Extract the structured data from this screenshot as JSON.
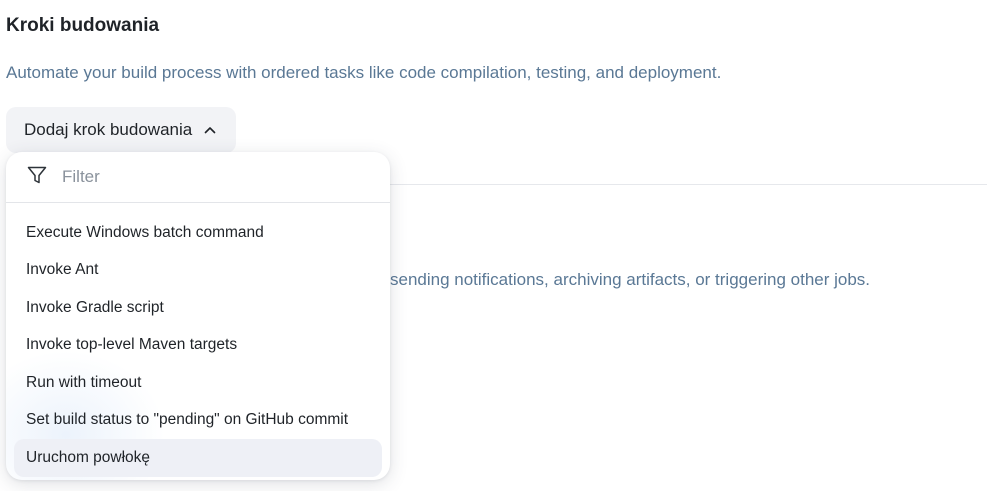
{
  "section": {
    "title": "Kroki budowania",
    "description": "Automate your build process with ordered tasks like code compilation, testing, and deployment."
  },
  "add_step_button": {
    "label": "Dodaj krok budowania",
    "icon": "chevron-up-icon"
  },
  "post_build": {
    "description_visible": "sending notifications, archiving artifacts, or triggering other jobs."
  },
  "dropdown": {
    "filter_placeholder": "Filter",
    "filter_icon": "filter-icon",
    "items": [
      {
        "label": "Execute Windows batch command",
        "active": false
      },
      {
        "label": "Invoke Ant",
        "active": false
      },
      {
        "label": "Invoke Gradle script",
        "active": false
      },
      {
        "label": "Invoke top-level Maven targets",
        "active": false
      },
      {
        "label": "Run with timeout",
        "active": false
      },
      {
        "label": "Set build status to \"pending\" on GitHub commit",
        "active": false
      },
      {
        "label": "Uruchom powłokę",
        "active": true
      }
    ]
  },
  "colors": {
    "muted_text": "#5a7895",
    "button_bg": "#f2f3f6",
    "active_item_bg": "#eef0f6"
  }
}
